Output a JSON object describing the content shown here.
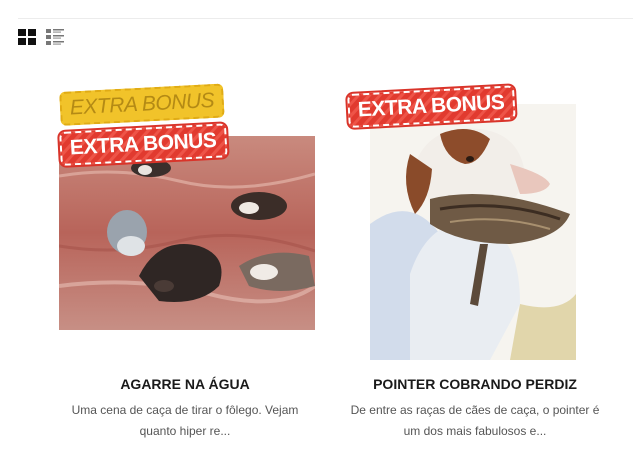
{
  "toolbar": {
    "grid_view_icon": "grid-icon",
    "list_view_icon": "list-icon"
  },
  "products": [
    {
      "badges": [
        "EXTRA BONUS",
        "EXTRA BONUS"
      ],
      "title": "AGARRE NA ÁGUA",
      "excerpt": "Uma cena de caça de tirar o fôlego. Vejam quanto hiper re..."
    },
    {
      "badges": [
        "EXTRA BONUS"
      ],
      "title": "POINTER COBRANDO PERDIZ",
      "excerpt": "De entre as raças de cães de caça, o pointer é um dos mais fabulosos e..."
    }
  ],
  "colors": {
    "badge_red": "#e13a2f",
    "badge_yellow": "#f1c32a",
    "title": "#1a1a1a",
    "excerpt": "#555555"
  }
}
